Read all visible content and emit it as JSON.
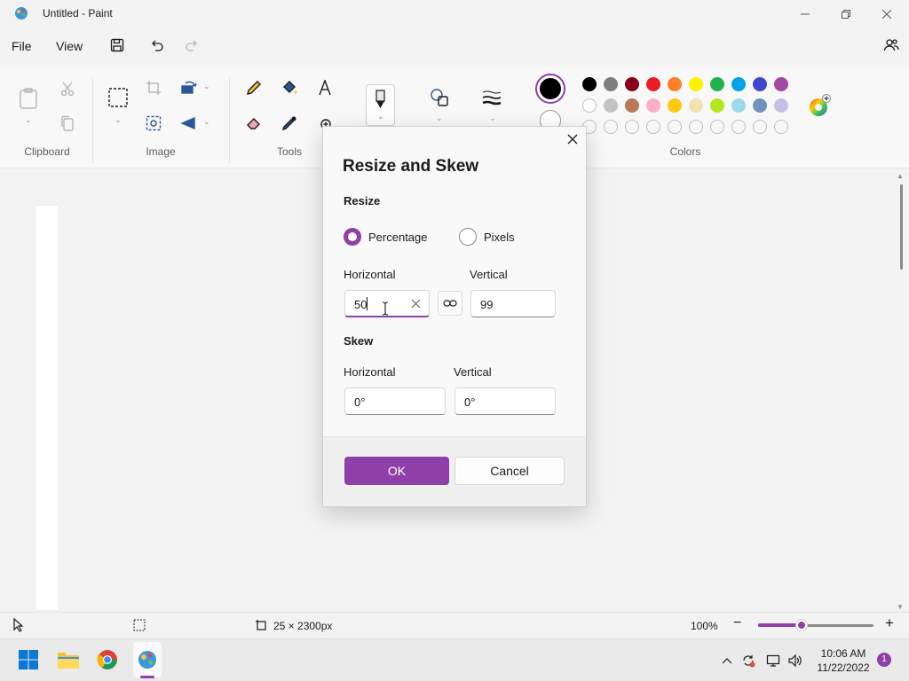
{
  "window": {
    "title": "Untitled - Paint"
  },
  "menu": {
    "file": "File",
    "view": "View"
  },
  "ribbon": {
    "groups": {
      "clipboard": "Clipboard",
      "image": "Image",
      "tools": "Tools",
      "colors": "Colors"
    }
  },
  "colors": {
    "accent": "#8f3fa8",
    "current_primary": "#000000",
    "current_secondary": "#ffffff",
    "palette_row1": [
      "#000000",
      "#7f7f7f",
      "#880015",
      "#ed1c24",
      "#ff7f27",
      "#fff200",
      "#22b14c",
      "#00a2e8",
      "#3f48cc",
      "#a349a4"
    ],
    "palette_row2": [
      "#ffffff",
      "#c3c3c3",
      "#b97a57",
      "#ffaec9",
      "#ffc90e",
      "#efe4b0",
      "#b5e61d",
      "#99d9ea",
      "#7092be",
      "#c8bfe7"
    ]
  },
  "dialog": {
    "title": "Resize and Skew",
    "resize_label": "Resize",
    "percentage_label": "Percentage",
    "pixels_label": "Pixels",
    "selected_mode": "Percentage",
    "resize_horizontal_label": "Horizontal",
    "resize_vertical_label": "Vertical",
    "resize_horizontal_value": "50",
    "resize_vertical_value": "99",
    "skew_label": "Skew",
    "skew_horizontal_label": "Horizontal",
    "skew_vertical_label": "Vertical",
    "skew_horizontal_value": "0°",
    "skew_vertical_value": "0°",
    "ok_label": "OK",
    "cancel_label": "Cancel"
  },
  "status": {
    "canvas_size": "25 × 2300px",
    "zoom": "100%",
    "zoom_fraction": 0.38
  },
  "taskbar": {
    "time": "10:06 AM",
    "date": "11/22/2022",
    "notifications": "1"
  }
}
